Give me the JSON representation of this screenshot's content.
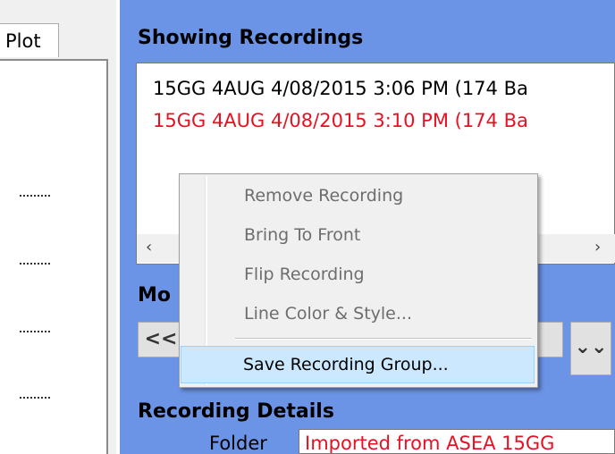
{
  "tabs": {
    "plot": "Plot"
  },
  "headings": {
    "showing_recordings": "Showing Recordings",
    "modify_partial": "Mo",
    "recording_details": "Recording Details"
  },
  "recordings": [
    {
      "label": "15GG 4AUG 4/08/2015 3:06 PM (174 Ba",
      "color": "#000000"
    },
    {
      "label": "15GG 4AUG 4/08/2015 3:10 PM (174 Ba",
      "color": "#e81123"
    }
  ],
  "scrollbar": {
    "left_arrow": "‹",
    "right_arrow": "›"
  },
  "controls": {
    "prev_label": "<<",
    "down_label": "⌄⌄"
  },
  "details": {
    "folder_label": "Folder",
    "folder_value": "Imported from ASEA 15GG"
  },
  "context_menu": {
    "items": [
      {
        "label": "Remove Recording",
        "enabled": false
      },
      {
        "label": "Bring To Front",
        "enabled": false
      },
      {
        "label": "Flip Recording",
        "enabled": false
      },
      {
        "label": "Line Color & Style...",
        "enabled": false
      },
      {
        "label": "Save Recording Group...",
        "enabled": true
      }
    ]
  },
  "colors": {
    "panel_blue": "#6b93e6",
    "highlight": "#cce8ff",
    "red_text": "#e81123"
  }
}
